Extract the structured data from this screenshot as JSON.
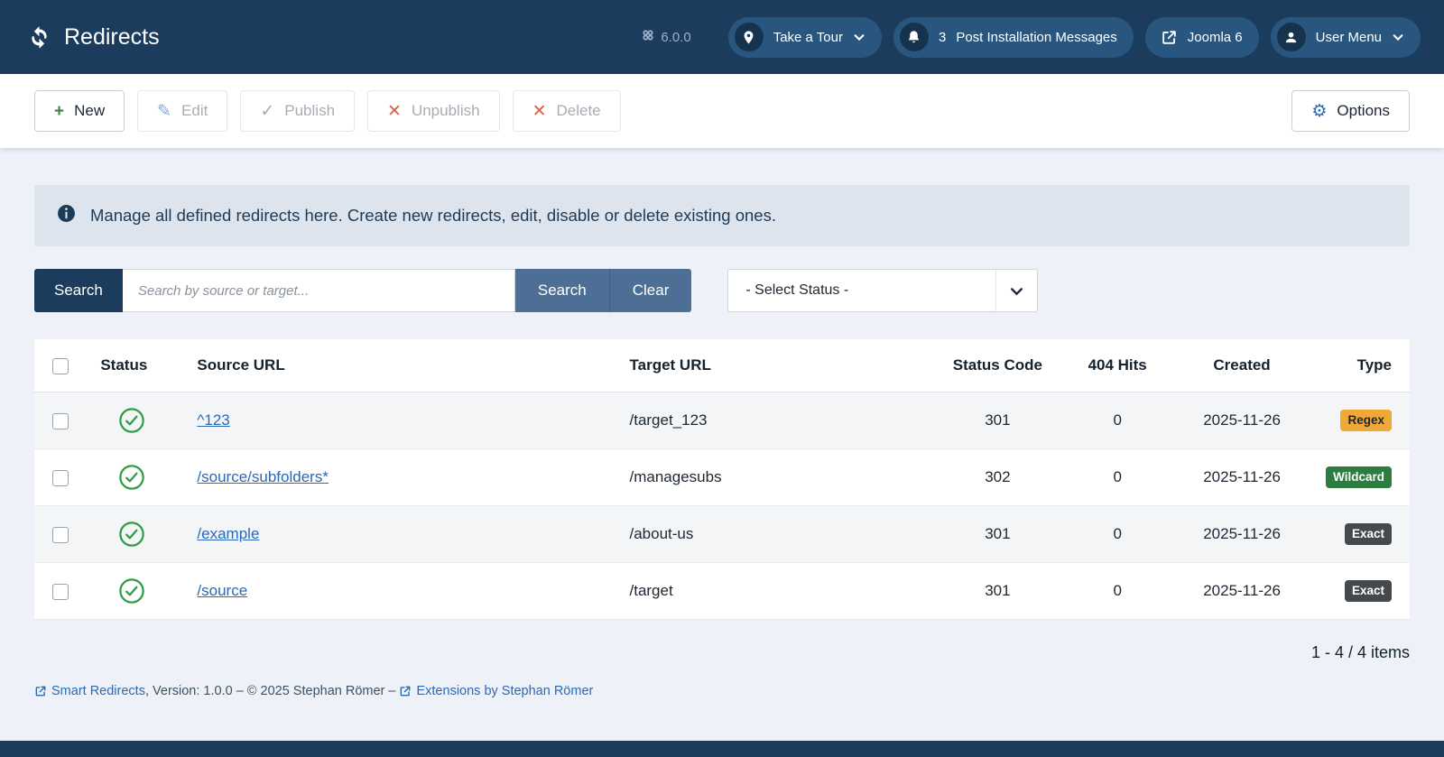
{
  "colors": {
    "header_bg": "#1b3c5d",
    "accent_blue": "#2a69b8",
    "status_green": "#2e9e44",
    "badge_regex": "#f0a936",
    "badge_wildcard": "#2c7d3f",
    "badge_exact": "#44494e",
    "filter_button": "#4d6f96"
  },
  "header": {
    "title": "Redirects",
    "version": "6.0.0",
    "tour_button": "Take a Tour",
    "messages_badge": "3",
    "messages_button": "Post Installation Messages",
    "joomla_button": "Joomla 6",
    "user_menu_button": "User Menu"
  },
  "toolbar": {
    "new": "New",
    "edit": "Edit",
    "publish": "Publish",
    "unpublish": "Unpublish",
    "delete": "Delete",
    "options": "Options"
  },
  "alert": "Manage all defined redirects here. Create new redirects, edit, disable or delete existing ones.",
  "filters": {
    "search_label": "Search",
    "search_placeholder": "Search by source or target...",
    "search_button": "Search",
    "clear_button": "Clear",
    "status_select": "- Select Status -"
  },
  "table": {
    "headers": {
      "status": "Status",
      "source": "Source URL",
      "target": "Target URL",
      "code": "Status Code",
      "hits": "404 Hits",
      "created": "Created",
      "type": "Type"
    },
    "rows": [
      {
        "source": "^123",
        "target": "/target_123",
        "code": "301",
        "hits": "0",
        "created": "2025-11-26",
        "type": "Regex"
      },
      {
        "source": "/source/subfolders*",
        "target": "/managesubs",
        "code": "302",
        "hits": "0",
        "created": "2025-11-26",
        "type": "Wildcard"
      },
      {
        "source": "/example",
        "target": "/about-us",
        "code": "301",
        "hits": "0",
        "created": "2025-11-26",
        "type": "Exact"
      },
      {
        "source": "/source",
        "target": "/target",
        "code": "301",
        "hits": "0",
        "created": "2025-11-26",
        "type": "Exact"
      }
    ]
  },
  "pagination": "1 - 4 / 4 items",
  "footer": {
    "link1": "Smart Redirects",
    "text": ", Version: 1.0.0 – © 2025 Stephan Römer – ",
    "link2": "Extensions by Stephan Römer"
  }
}
